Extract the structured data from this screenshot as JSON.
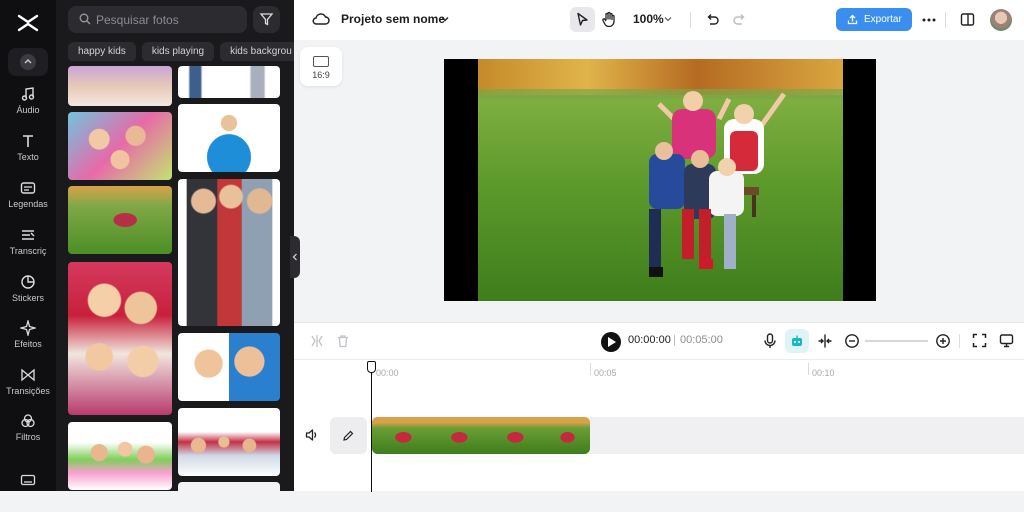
{
  "sidebar": {
    "items": [
      {
        "label": "Áudio",
        "icon": "music-note-icon"
      },
      {
        "label": "Texto",
        "icon": "text-icon"
      },
      {
        "label": "Legendas",
        "icon": "captions-icon"
      },
      {
        "label": "Transcriç",
        "icon": "transcript-icon"
      },
      {
        "label": "Stickers",
        "icon": "sticker-icon"
      },
      {
        "label": "Efeitos",
        "icon": "effects-icon"
      },
      {
        "label": "Transições",
        "icon": "transitions-icon"
      },
      {
        "label": "Filtros",
        "icon": "filters-icon"
      }
    ]
  },
  "panel": {
    "search_placeholder": "Pesquisar fotos",
    "chips": [
      "happy kids",
      "kids playing",
      "kids backgrou"
    ]
  },
  "topbar": {
    "project_title": "Projeto sem nome",
    "zoom": "100%",
    "export_label": "Exportar"
  },
  "canvas": {
    "aspect_ratio": "16:9"
  },
  "timeline": {
    "current_time": "00:00:00",
    "separator": "|",
    "total_time": "00:05:00",
    "ruler": [
      "00:00",
      "00:05",
      "00:10"
    ]
  },
  "colors": {
    "accent": "#3a8ef0",
    "sidebar_bg": "#0f0f11",
    "panel_bg": "#1a1a1d",
    "clip_green": "#4f8f28"
  }
}
